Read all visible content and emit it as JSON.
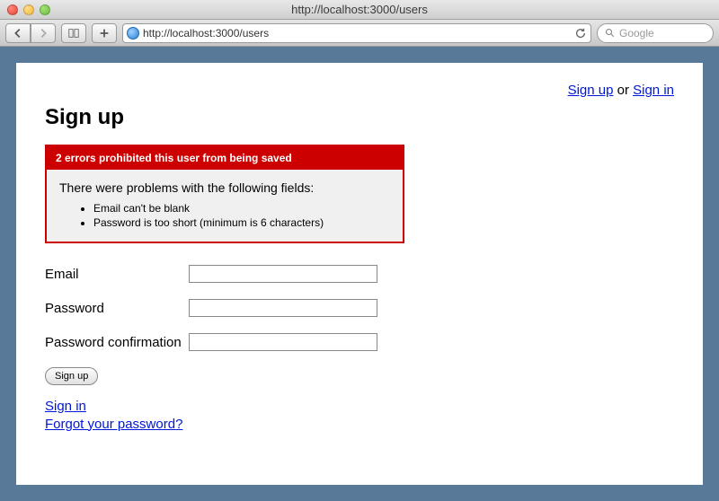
{
  "browser": {
    "title": "http://localhost:3000/users",
    "url": "http://localhost:3000/users",
    "search_placeholder": "Google"
  },
  "nav": {
    "sign_up": "Sign up",
    "or": " or ",
    "sign_in": "Sign in"
  },
  "page": {
    "heading": "Sign up"
  },
  "errors": {
    "header": "2 errors prohibited this user from being saved",
    "intro": "There were problems with the following fields:",
    "items": [
      "Email can't be blank",
      "Password is too short (minimum is 6 characters)"
    ]
  },
  "form": {
    "email_label": "Email",
    "email_value": "",
    "password_label": "Password",
    "password_value": "",
    "password_confirmation_label": "Password confirmation",
    "password_confirmation_value": "",
    "submit_label": "Sign up"
  },
  "links": {
    "sign_in": "Sign in",
    "forgot_password": "Forgot your password?"
  }
}
